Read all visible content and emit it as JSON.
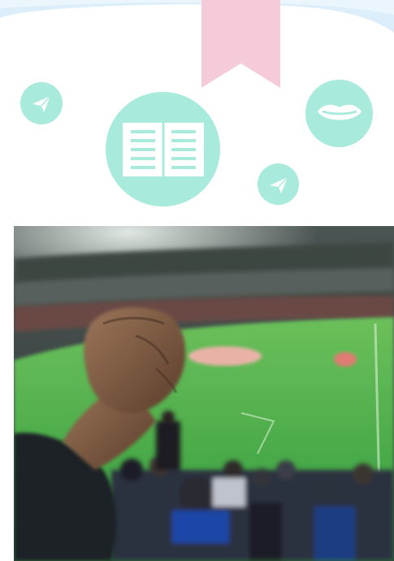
{
  "colors": {
    "mint": "#a8eadb",
    "pink": "#f6cbd9",
    "wave": "#dbeefa",
    "white": "#ffffff"
  },
  "icons": {
    "top_left": "paper-plane-icon",
    "center": "open-book-icon",
    "top_right": "lips-icon",
    "bottom_right": "paper-plane-icon",
    "ribbon": "bookmark-ribbon-icon"
  },
  "photo": {
    "subject": "fan-raised-fist-stadium-photo"
  }
}
